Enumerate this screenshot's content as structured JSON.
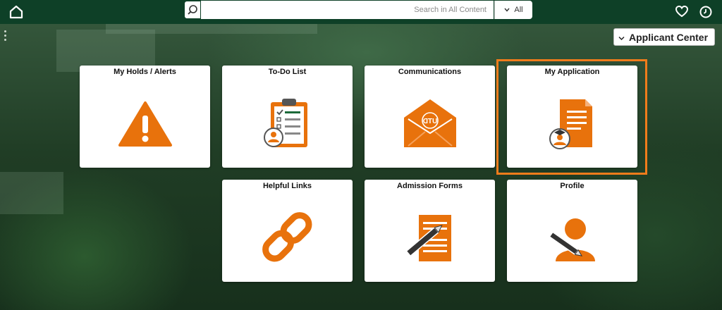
{
  "topbar": {
    "search_placeholder": "Search in All Content",
    "scope_value": "All"
  },
  "homepage_selector": {
    "label": "Applicant Center"
  },
  "tiles": [
    {
      "label": "My Holds / Alerts",
      "icon": "warning-icon"
    },
    {
      "label": "To-Do List",
      "icon": "clipboard-checklist-icon"
    },
    {
      "label": "Communications",
      "icon": "envelope-icon"
    },
    {
      "label": "My Application",
      "icon": "application-document-icon"
    },
    {
      "label": "Helpful Links",
      "icon": "chain-link-icon"
    },
    {
      "label": "Admission Forms",
      "icon": "form-pencil-icon"
    },
    {
      "label": "Profile",
      "icon": "user-pencil-icon"
    }
  ],
  "envelope_logo_text": "UTD",
  "colors": {
    "accent": "#e8720c",
    "banner": "#0e4027",
    "highlight": "#f07c1b"
  }
}
